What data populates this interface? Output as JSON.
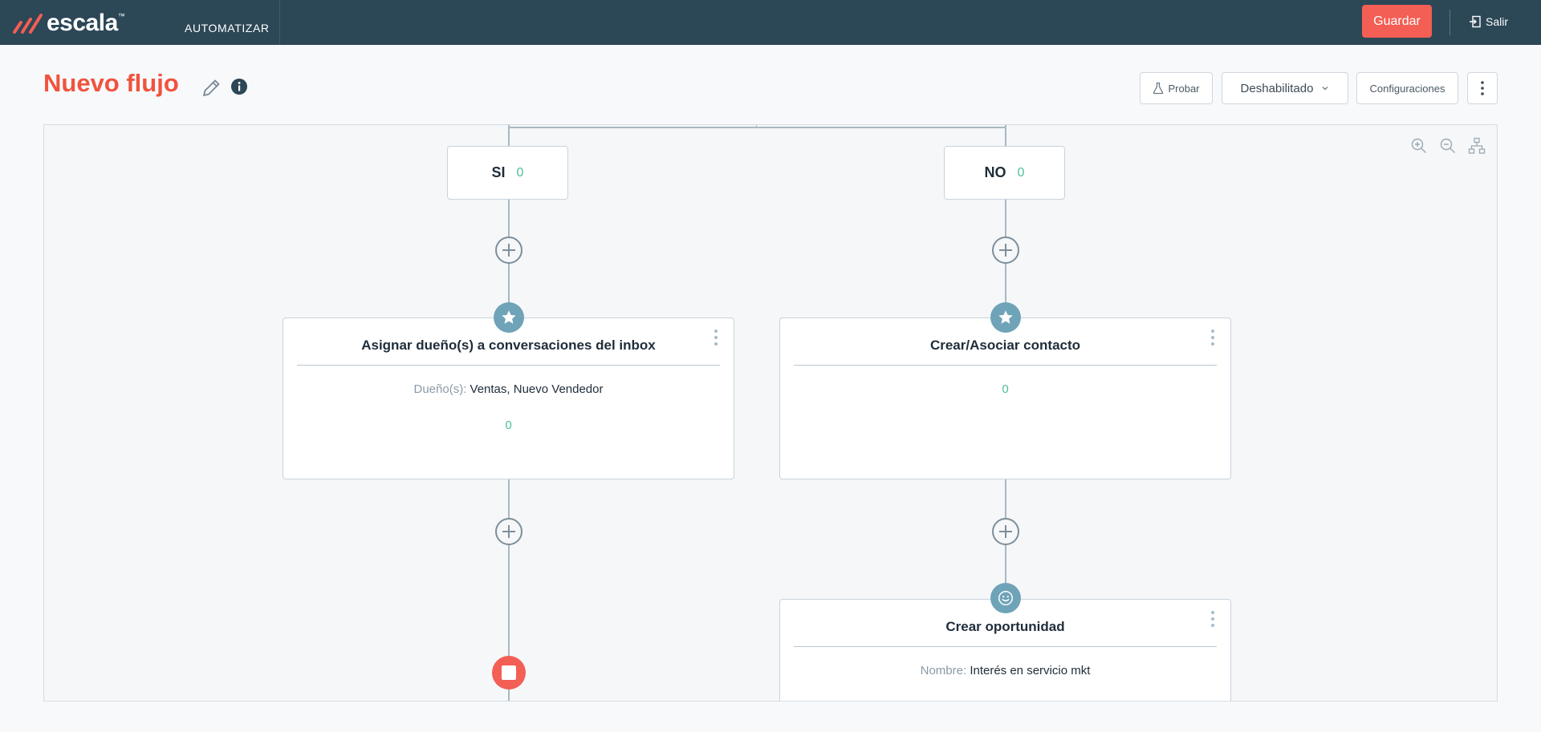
{
  "app": {
    "logo_text": "escala",
    "logo_tm": "™",
    "section": "AUTOMATIZAR",
    "save_label": "Guardar",
    "exit_label": "Salir"
  },
  "header": {
    "title": "Nuevo flujo",
    "test_label": "Probar",
    "status_value": "Deshabilitado",
    "config_label": "Configuraciones",
    "icons": [
      "pencil-icon",
      "info-icon",
      "flask-icon",
      "chevron-down-icon",
      "kebab-icon"
    ]
  },
  "canvas": {
    "zoom_icons": [
      "zoom-in-icon",
      "zoom-out-icon",
      "layout-tree-icon"
    ],
    "branches": [
      {
        "label": "SI",
        "count": "0"
      },
      {
        "label": "NO",
        "count": "0"
      }
    ],
    "cards": [
      {
        "title": "Asignar dueño(s) a conversaciones del inbox",
        "field_label": "Dueño(s):",
        "field_value": "Ventas, Nuevo Vendedor",
        "count": "0",
        "icon": "star-icon"
      },
      {
        "title": "Crear/Asociar contacto",
        "count": "0",
        "icon": "star-icon"
      },
      {
        "title": "Crear oportunidad",
        "field_label": "Nombre:",
        "field_value": "Interés en servicio mkt",
        "icon": "smiley-icon"
      }
    ]
  },
  "colors": {
    "topbar": "#2c4756",
    "accent": "#f35e55",
    "title": "#f0533e",
    "count": "#4bbf9c",
    "badge": "#6fa3b8"
  }
}
